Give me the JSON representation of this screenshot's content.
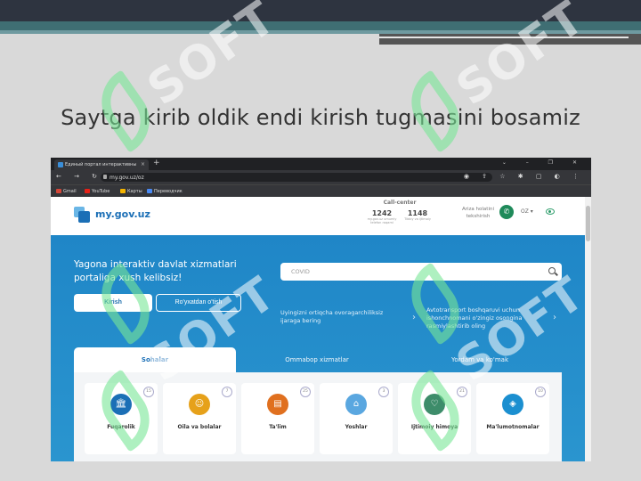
{
  "slide": {
    "title": "Saytga kirib oldik endi kirish tugmasini bosamiz",
    "watermark": "SOFT"
  },
  "browser": {
    "tab_title": "Единый портал интерактивны",
    "tab_close": "×",
    "new_tab": "+",
    "window_controls": "⌄ – ❐ ✕",
    "nav_buttons": "← → ↻ ⌂",
    "url": "my.gov.uz/oz",
    "extension_icons": "◉ ⇪ ☆ ✱ ▢ ◐ ⋮",
    "bookmarks": [
      {
        "label": "Gmail",
        "color": "#d44638"
      },
      {
        "label": "YouTube",
        "color": "#e62117"
      },
      {
        "label": "Карты",
        "color": "#f4b400"
      },
      {
        "label": "Переводчик",
        "color": "#4a8af4"
      }
    ]
  },
  "site": {
    "logo": "my.gov.uz",
    "call_center": {
      "title": "Call-center",
      "items": [
        {
          "value": "1242",
          "sub": "my.gov.uz umumiy telefon raqami"
        },
        {
          "value": "1148",
          "sub": "Tibbiy va ijtimoiy"
        }
      ]
    },
    "ariza": "Ariza holatini tekshirish",
    "phone_icon": "✆",
    "language": "OZ ▾",
    "hero": {
      "title": "Yagona interaktiv davlat xizmatlari portaliga xush kelibsiz!",
      "login_button": "Kirish",
      "register_button": "Ro'yxatdan o'tish",
      "search_placeholder": "COVID",
      "promo1": "Uyingizni ortiqcha ovoragarchiliksiz ijaraga bering",
      "promo2": "Avtotransport boshqaruvi uchun ishonchnomani o'zingiz osongina rasmiylashtirib oling",
      "chevron": "›"
    },
    "tabs": [
      "Sohalar",
      "Ommabop xizmatlar",
      "Yordam va ko'mak"
    ],
    "cards": [
      {
        "label": "Fuqarolik",
        "count": "15",
        "icon": "🏛",
        "color": "#1b6fb6"
      },
      {
        "label": "Oila va bolalar",
        "count": "7",
        "icon": "☺",
        "color": "#e6a11a"
      },
      {
        "label": "Ta'lim",
        "count": "25",
        "icon": "▤",
        "color": "#e0701f"
      },
      {
        "label": "Yoshlar",
        "count": "3",
        "icon": "⌂",
        "color": "#5aa7e0"
      },
      {
        "label": "Ijtimoiy himoya",
        "count": "21",
        "icon": "♡",
        "color": "#3d8c6a"
      },
      {
        "label": "Ma'lumotnomalar",
        "count": "10",
        "icon": "◈",
        "color": "#1b8fd0"
      }
    ]
  }
}
